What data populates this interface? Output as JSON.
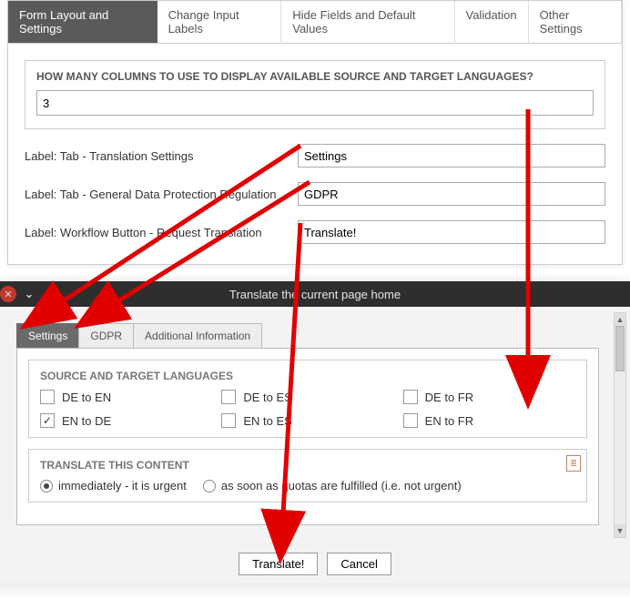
{
  "config": {
    "tabs": [
      "Form Layout and Settings",
      "Change Input Labels",
      "Hide Fields and Default Values",
      "Validation",
      "Other Settings"
    ],
    "columns_title": "HOW MANY COLUMNS TO USE TO DISPLAY AVAILABLE SOURCE AND TARGET LANGUAGES?",
    "columns_value": "3",
    "field1_label": "Label: Tab - Translation Settings",
    "field1_value": "Settings",
    "field2_label": "Label: Tab - General Data Protection Regulation",
    "field2_value": "GDPR",
    "field3_label": "Label: Workflow Button - Request Translation",
    "field3_value": "Translate!"
  },
  "dialog": {
    "title": "Translate the current page home",
    "tabs": [
      "Settings",
      "GDPR",
      "Additional Information"
    ],
    "src_tgt_title": "SOURCE AND TARGET LANGUAGES",
    "langs": [
      {
        "label": "DE to EN",
        "checked": false
      },
      {
        "label": "DE to ES",
        "checked": false
      },
      {
        "label": "DE to FR",
        "checked": false
      },
      {
        "label": "EN to DE",
        "checked": true
      },
      {
        "label": "EN to ES",
        "checked": false
      },
      {
        "label": "EN to FR",
        "checked": false
      }
    ],
    "content_title": "TRANSLATE THIS CONTENT",
    "radio_immediate": "immediately - it is urgent",
    "radio_quota": "as soon as quotas are fulfilled (i.e. not urgent)",
    "btn_translate": "Translate!",
    "btn_cancel": "Cancel"
  }
}
